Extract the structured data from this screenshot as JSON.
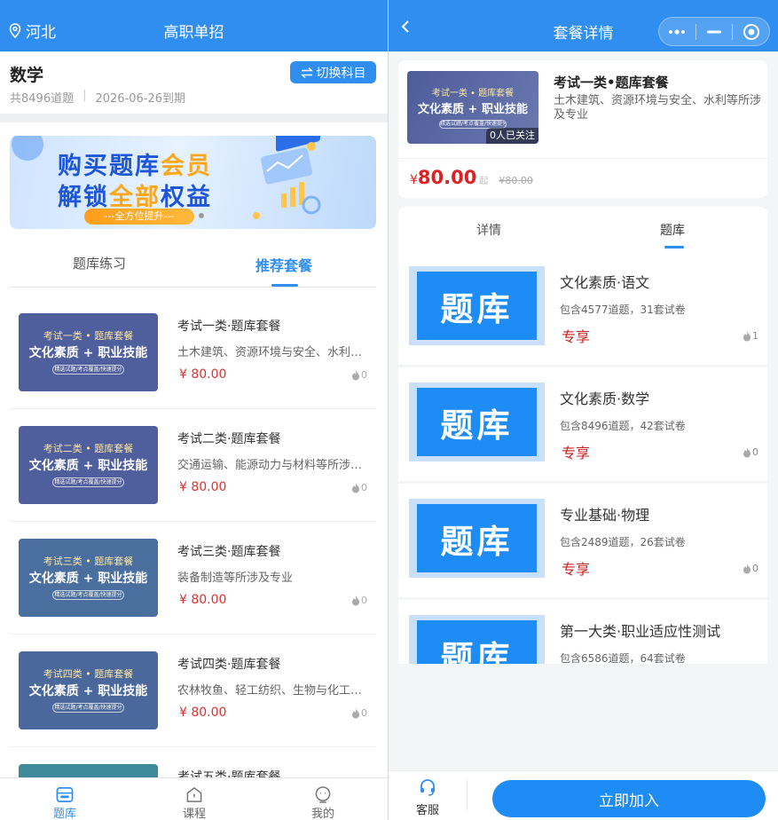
{
  "colors": {
    "primary": "#2f8ef0",
    "price": "#e03030",
    "exclusive": "#c82020"
  },
  "left": {
    "header": {
      "location": "河北",
      "title": "高职单招",
      "location_icon": "location-pin-icon"
    },
    "subject": {
      "name": "数学",
      "count": "共8496道题",
      "separator": "|",
      "expire": "2026-06-26到期",
      "switch_label": "切换科目"
    },
    "banner": {
      "line1_a": "购买题库",
      "line1_b": "会员",
      "line2_a": "解锁",
      "line2_b": "全部",
      "line2_c": "权益",
      "pill": "---全方位提升---"
    },
    "tabs": [
      {
        "label": "题库练习"
      },
      {
        "label": "推荐套餐"
      }
    ],
    "packages": [
      {
        "thumb_top": "考试一类 • 题库套餐",
        "thumb_main": "文化素质 + 职业技能",
        "thumb_sub": "精选试题/考点覆盖/快速提分",
        "title": "考试一类·题库套餐",
        "desc": "土木建筑、资源环境与安全、水利等...",
        "price": "¥ 80.00",
        "likes": "0",
        "color": "#4f5e9c"
      },
      {
        "thumb_top": "考试二类 • 题库套餐",
        "thumb_main": "文化素质 + 职业技能",
        "thumb_sub": "精选试题/考点覆盖/快速提分",
        "title": "考试二类·题库套餐",
        "desc": "交通运输、能源动力与材料等所涉及...",
        "price": "¥ 80.00",
        "likes": "0",
        "color": "#4f5e9c"
      },
      {
        "thumb_top": "考试三类 • 题库套餐",
        "thumb_main": "文化素质 + 职业技能",
        "thumb_sub": "精选试题/考点覆盖/快速提分",
        "title": "考试三类·题库套餐",
        "desc": "装备制造等所涉及专业",
        "price": "¥ 80.00",
        "likes": "0",
        "color": "#4a6f9e"
      },
      {
        "thumb_top": "考试四类 • 题库套餐",
        "thumb_main": "文化素质 + 职业技能",
        "thumb_sub": "精选试题/考点覆盖/快速提分",
        "title": "考试四类·题库套餐",
        "desc": "农林牧鱼、轻工纺织、生物与化工、...",
        "price": "¥ 80.00",
        "likes": "0",
        "color": "#4a689c"
      },
      {
        "thumb_top": "",
        "thumb_main": "",
        "thumb_sub": "",
        "title": "考试五类·题库套餐",
        "desc": "",
        "price": "",
        "likes": "",
        "color": "#3f8a9a"
      }
    ],
    "nav": [
      {
        "label": "题库",
        "icon": "question-bank-icon"
      },
      {
        "label": "课程",
        "icon": "course-icon"
      },
      {
        "label": "我的",
        "icon": "profile-icon"
      }
    ]
  },
  "right": {
    "header": {
      "title": "套餐详情",
      "back_icon": "chevron-left-icon",
      "more_icon": "more-dots-icon",
      "minimize_icon": "minimize-icon",
      "close_icon": "target-close-icon"
    },
    "package": {
      "thumb_top": "考试一类 • 题库套餐",
      "thumb_main": "文化素质 + 职业技能",
      "thumb_sub": "精选试题/考点覆盖/快速提分",
      "followers": "0人已关注",
      "title": "考试一类•题库套餐",
      "desc": "土木建筑、资源环境与安全、水利等所涉及专业",
      "currency": "¥",
      "price": "80.00",
      "price_suffix": "起",
      "original_price": "¥80.00"
    },
    "tabs": [
      {
        "label": "详情"
      },
      {
        "label": "题库"
      }
    ],
    "banks": [
      {
        "thumb_label": "题库",
        "title": "文化素质·语文",
        "contains": "包含4577道题，31套试卷",
        "tag": "专享",
        "likes": "1"
      },
      {
        "thumb_label": "题库",
        "title": "文化素质·数学",
        "contains": "包含8496道题，42套试卷",
        "tag": "专享",
        "likes": "0"
      },
      {
        "thumb_label": "题库",
        "title": "专业基础·物理",
        "contains": "包含2489道题，26套试卷",
        "tag": "专享",
        "likes": "0"
      },
      {
        "thumb_label": "题库",
        "title": "第一大类·职业适应性测试",
        "contains": "包含6586道题，64套试卷",
        "tag": "",
        "likes": ""
      }
    ],
    "footer": {
      "service_label": "客服",
      "service_icon": "headset-icon",
      "join_label": "立即加入"
    }
  }
}
